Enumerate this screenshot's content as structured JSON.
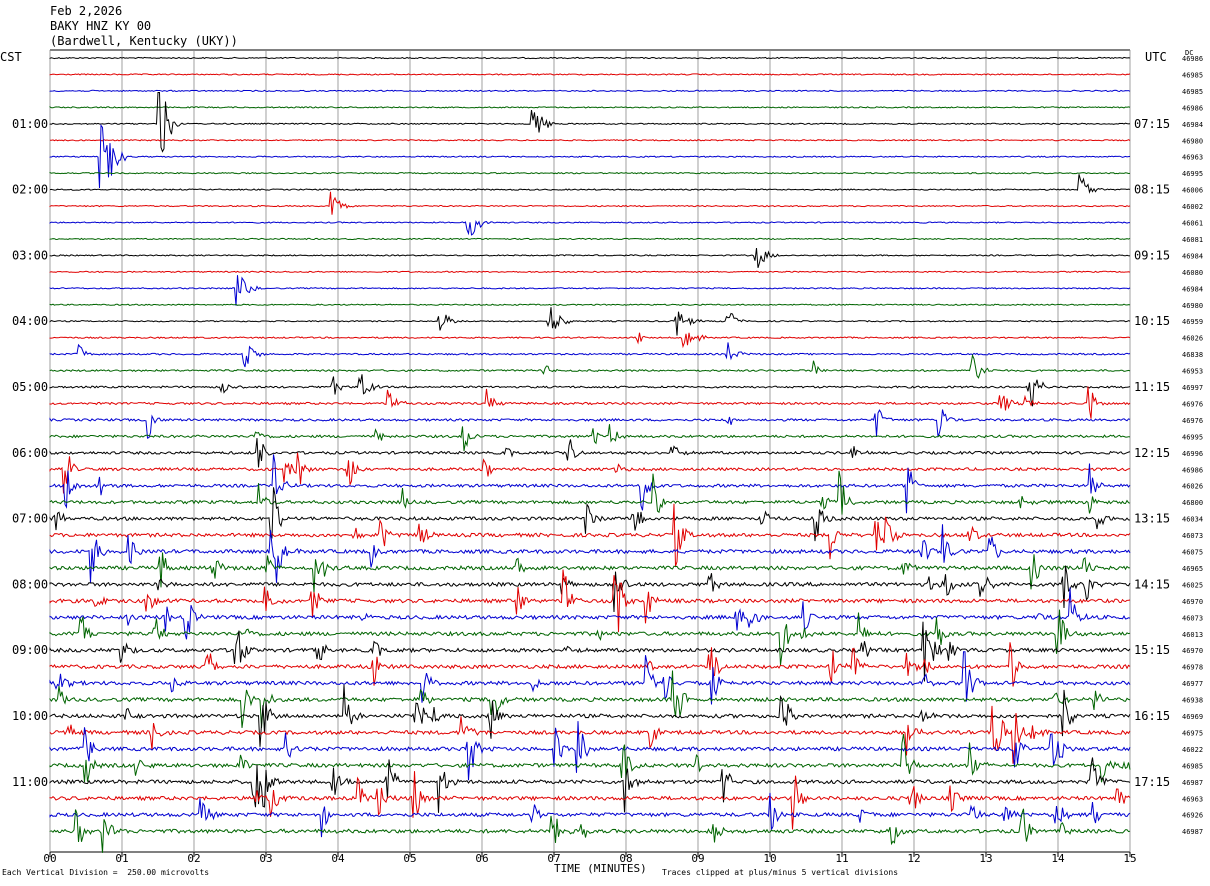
{
  "header": {
    "date": "Feb 2,2026",
    "station": "BAKY HNZ KY 00",
    "location": "(Bardwell, Kentucky (UKY))"
  },
  "axes": {
    "left_tz": "CST",
    "right_tz": "UTC",
    "dc_label": "DC",
    "x_label": "TIME (MINUTES)"
  },
  "footer": {
    "scale_note": "Each Vertical Division =  250.00 microvolts",
    "clip_note": "Traces clipped at plus/minus 5 vertical divisions"
  },
  "colors": {
    "trace_colors": [
      "#000000",
      "#e00000",
      "#0000d0",
      "#006400"
    ],
    "grid": "#888888"
  },
  "chart_data": {
    "type": "line",
    "title": "BAKY HNZ KY 00",
    "xlabel": "TIME (MINUTES)",
    "xlim": [
      0,
      15
    ],
    "x_ticks": [
      "00",
      "01",
      "02",
      "03",
      "04",
      "05",
      "06",
      "07",
      "08",
      "09",
      "10",
      "11",
      "12",
      "13",
      "14",
      "15"
    ],
    "minutes_per_row": 15,
    "row_count": 48,
    "rows_start_cst": "00:00",
    "left_time_labels": [
      {
        "row": 4,
        "label": "01:00"
      },
      {
        "row": 8,
        "label": "02:00"
      },
      {
        "row": 12,
        "label": "03:00"
      },
      {
        "row": 16,
        "label": "04:00"
      },
      {
        "row": 20,
        "label": "05:00"
      },
      {
        "row": 24,
        "label": "06:00"
      },
      {
        "row": 28,
        "label": "07:00"
      },
      {
        "row": 32,
        "label": "08:00"
      },
      {
        "row": 36,
        "label": "09:00"
      },
      {
        "row": 40,
        "label": "10:00"
      },
      {
        "row": 44,
        "label": "11:00"
      }
    ],
    "right_time_labels": [
      {
        "row": 4,
        "label": "07:15"
      },
      {
        "row": 8,
        "label": "08:15"
      },
      {
        "row": 12,
        "label": "09:15"
      },
      {
        "row": 16,
        "label": "10:15"
      },
      {
        "row": 20,
        "label": "11:15"
      },
      {
        "row": 24,
        "label": "12:15"
      },
      {
        "row": 28,
        "label": "13:15"
      },
      {
        "row": 32,
        "label": "14:15"
      },
      {
        "row": 36,
        "label": "15:15"
      },
      {
        "row": 40,
        "label": "16:15"
      },
      {
        "row": 44,
        "label": "17:15"
      }
    ],
    "dc_offsets": [
      "46986",
      "46985",
      "46985",
      "46986",
      "46984",
      "46980",
      "46963",
      "46995",
      "46006",
      "46002",
      "46061",
      "46081",
      "46984",
      "46080",
      "46984",
      "46980",
      "46959",
      "46026",
      "46838",
      "46953",
      "46997",
      "46976",
      "46976",
      "46995",
      "46996",
      "46986",
      "46026",
      "46800",
      "46034",
      "46073",
      "46075",
      "46965",
      "46025",
      "46970",
      "46073",
      "46013",
      "46970",
      "46978",
      "46977",
      "46938",
      "46969",
      "46975",
      "46022",
      "46985",
      "46987",
      "46963",
      "46926",
      "46987"
    ],
    "events": [
      {
        "row": 4,
        "minute": 1.5,
        "amp": 4
      },
      {
        "row": 4,
        "minute": 6.7,
        "amp": 2
      },
      {
        "row": 6,
        "minute": 0.7,
        "amp": 6
      },
      {
        "row": 8,
        "minute": 14.3,
        "amp": 1.5
      },
      {
        "row": 9,
        "minute": 3.9,
        "amp": 1
      },
      {
        "row": 10,
        "minute": 5.8,
        "amp": 1.5
      },
      {
        "row": 12,
        "minute": 9.8,
        "amp": 1.2
      },
      {
        "row": 14,
        "minute": 2.6,
        "amp": 1.3
      },
      {
        "row": 16,
        "minute": 5.4,
        "amp": 1
      },
      {
        "row": 16,
        "minute": 6.9,
        "amp": 2
      },
      {
        "row": 16,
        "minute": 8.7,
        "amp": 1.2
      },
      {
        "row": 16,
        "minute": 9.4,
        "amp": 1
      },
      {
        "row": 17,
        "minute": 8.8,
        "amp": 1.2
      },
      {
        "row": 18,
        "minute": 2.7,
        "amp": 1
      },
      {
        "row": 18,
        "minute": 9.4,
        "amp": 1
      },
      {
        "row": 19,
        "minute": 12.8,
        "amp": 1.3
      },
      {
        "row": 20,
        "minute": 4.3,
        "amp": 1.2
      },
      {
        "row": 20,
        "minute": 13.6,
        "amp": 1.3
      },
      {
        "row": 21,
        "minute": 4.7,
        "amp": 1
      },
      {
        "row": 21,
        "minute": 13.2,
        "amp": 1
      }
    ],
    "clip_divisions": 5
  }
}
